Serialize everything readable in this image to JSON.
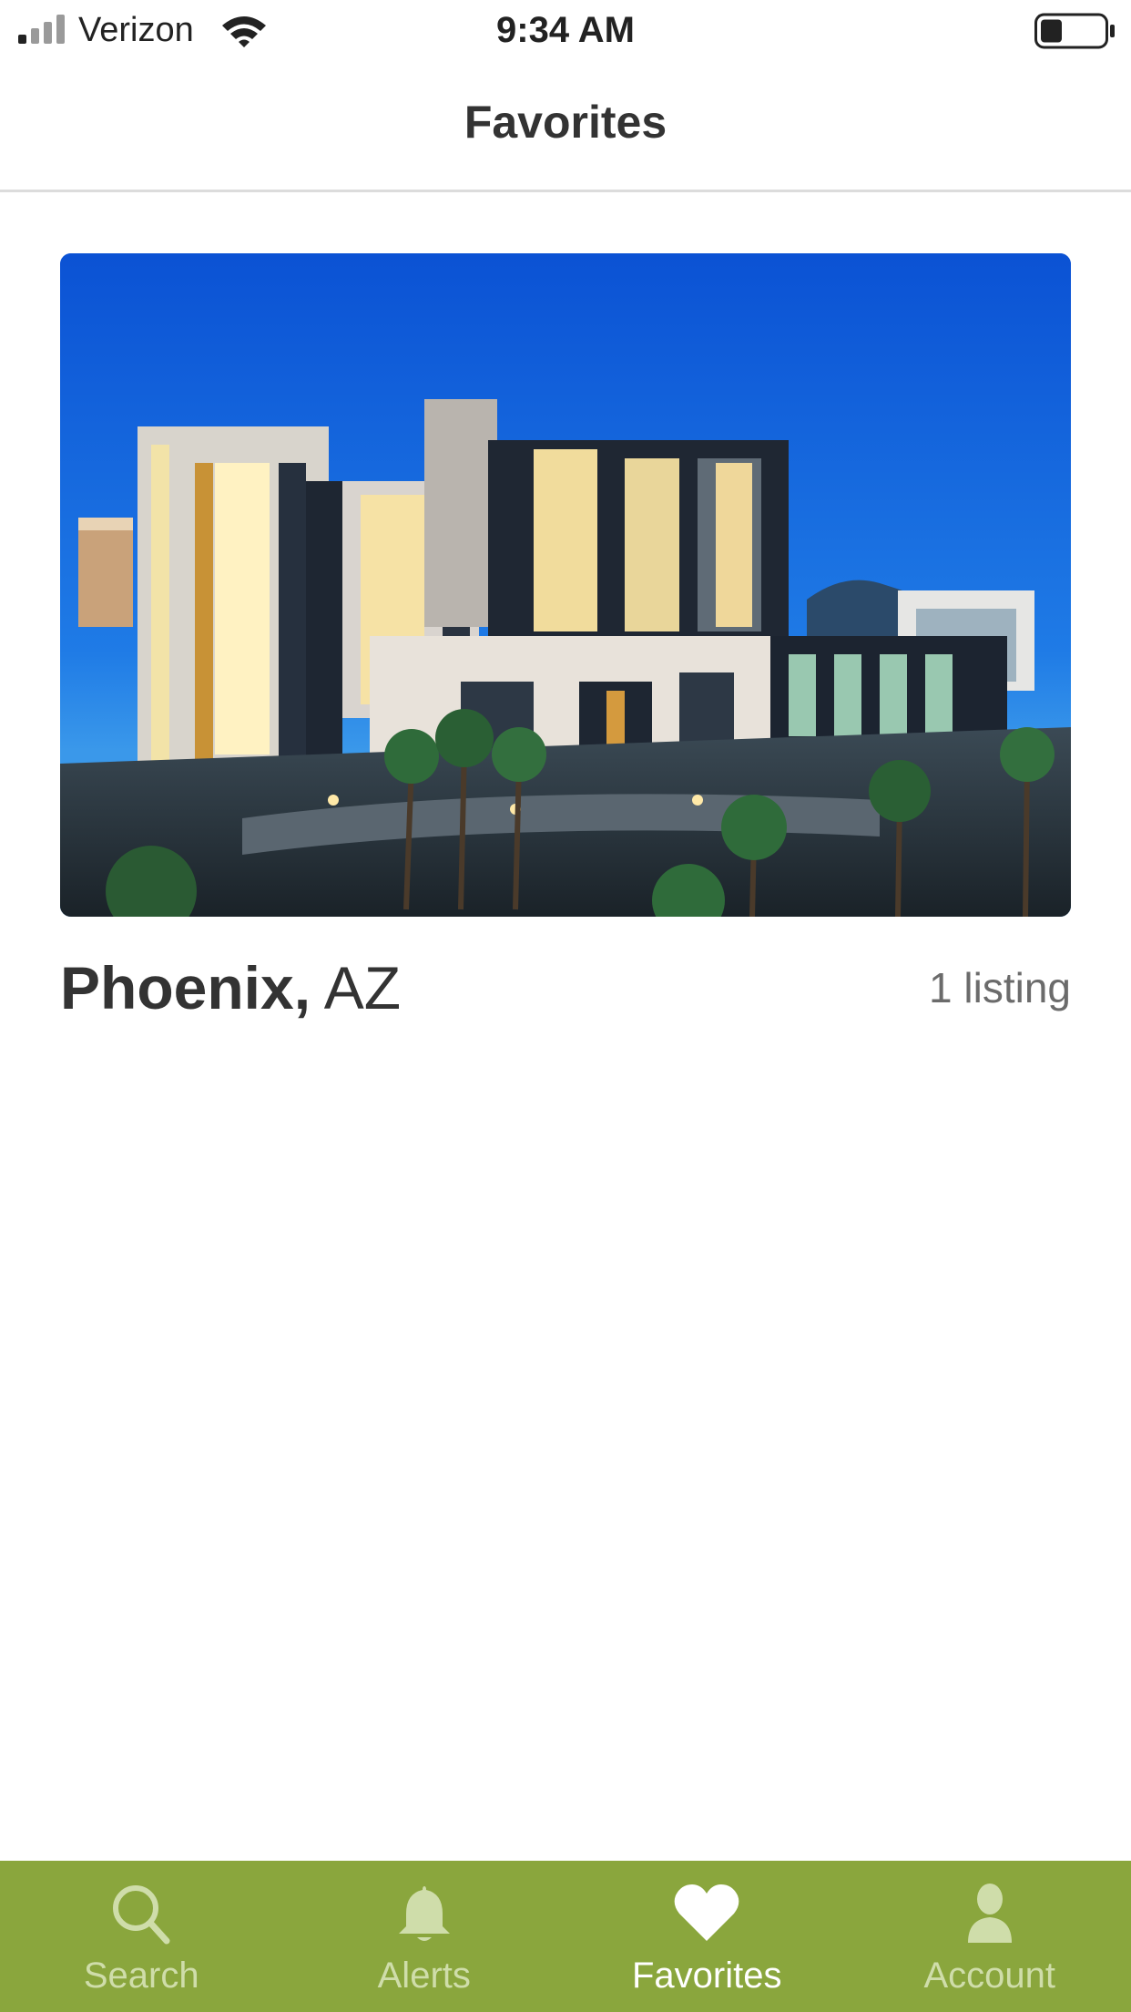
{
  "status_bar": {
    "carrier": "Verizon",
    "time": "9:34 AM",
    "battery_level": 0.35
  },
  "nav": {
    "title": "Favorites"
  },
  "favorites": [
    {
      "city": "Phoenix,",
      "state": "AZ",
      "count_label": "1 listing"
    }
  ],
  "tab_bar": {
    "background": "#8aa63d",
    "active_color": "#ffffff",
    "inactive_color": "#cfddaa",
    "active_index": 2,
    "tabs": [
      {
        "label": "Search",
        "icon": "search-icon"
      },
      {
        "label": "Alerts",
        "icon": "bell-icon"
      },
      {
        "label": "Favorites",
        "icon": "heart-icon"
      },
      {
        "label": "Account",
        "icon": "user-icon"
      }
    ]
  }
}
